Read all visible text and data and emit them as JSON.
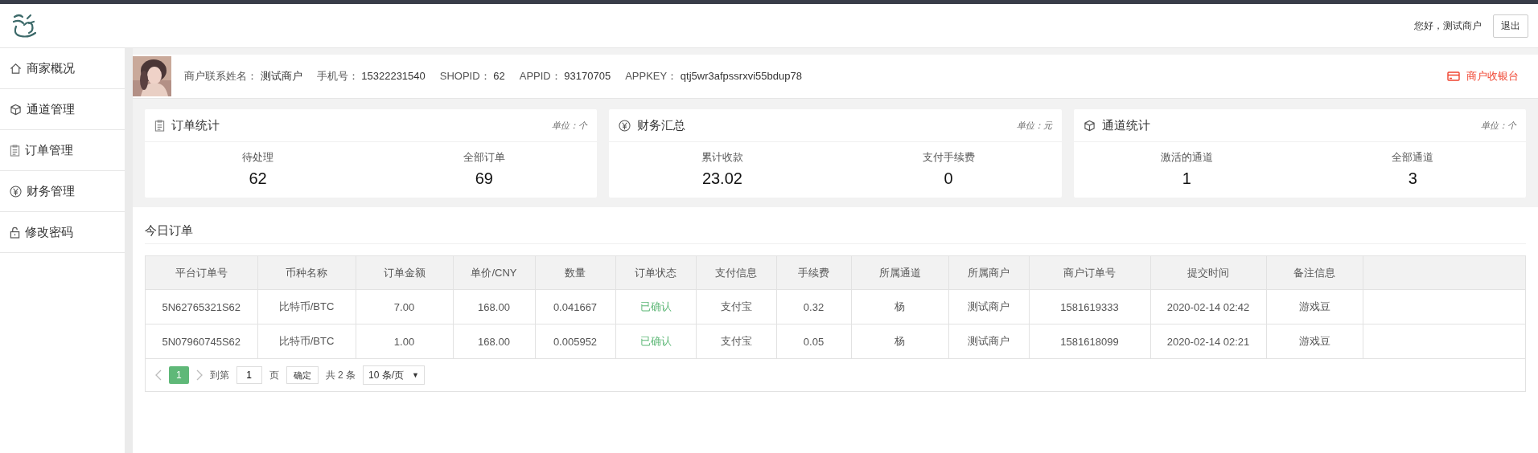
{
  "header": {
    "greeting": "您好，测试商户",
    "logout": "退出"
  },
  "sidebar": {
    "items": [
      {
        "label": "商家概况",
        "selected": false
      },
      {
        "label": "通道管理",
        "selected": false
      },
      {
        "label": "订单管理",
        "selected": false
      },
      {
        "label": "财务管理",
        "selected": false
      },
      {
        "label": "修改密码",
        "selected": false
      }
    ]
  },
  "merchant": {
    "fields": [
      {
        "label": "商户联系姓名：",
        "value": "测试商户"
      },
      {
        "label": "手机号：",
        "value": "15322231540"
      },
      {
        "label": "SHOPID：",
        "value": "62"
      },
      {
        "label": "APPID：",
        "value": "93170705"
      },
      {
        "label": "APPKEY：",
        "value": "qtj5wr3afpssrxvi55bdup78"
      }
    ],
    "cashier": "商户收银台"
  },
  "cards": [
    {
      "title": "订单统计",
      "unit": "单位：个",
      "stats": [
        {
          "label": "待处理",
          "value": "62"
        },
        {
          "label": "全部订单",
          "value": "69"
        }
      ]
    },
    {
      "title": "财务汇总",
      "unit": "单位：元",
      "stats": [
        {
          "label": "累计收款",
          "value": "23.02"
        },
        {
          "label": "支付手续费",
          "value": "0"
        }
      ]
    },
    {
      "title": "通道统计",
      "unit": "单位：个",
      "stats": [
        {
          "label": "激活的通道",
          "value": "1"
        },
        {
          "label": "全部通道",
          "value": "3"
        }
      ]
    }
  ],
  "orders": {
    "title": "今日订单",
    "columns": [
      {
        "label": "平台订单号",
        "kind": "text"
      },
      {
        "label": "币种名称",
        "kind": "text"
      },
      {
        "label": "订单金额",
        "kind": "text"
      },
      {
        "label": "单价/CNY",
        "kind": "text"
      },
      {
        "label": "数量",
        "kind": "text"
      },
      {
        "label": "订单状态",
        "kind": "status"
      },
      {
        "label": "支付信息",
        "kind": "text"
      },
      {
        "label": "手续费",
        "kind": "text"
      },
      {
        "label": "所属通道",
        "kind": "text"
      },
      {
        "label": "所属商户",
        "kind": "text"
      },
      {
        "label": "商户订单号",
        "kind": "text"
      },
      {
        "label": "提交时间",
        "kind": "text"
      },
      {
        "label": "备注信息",
        "kind": "text"
      }
    ],
    "rows": [
      [
        "5N62765321S62",
        "比特币/BTC",
        "7.00",
        "168.00",
        "0.041667",
        "已确认",
        "支付宝",
        "0.32",
        "杨",
        "测试商户",
        "1581619333",
        "2020-02-14 02:42",
        "游戏豆"
      ],
      [
        "5N07960745S62",
        "比特币/BTC",
        "1.00",
        "168.00",
        "0.005952",
        "已确认",
        "支付宝",
        "0.05",
        "杨",
        "测试商户",
        "1581618099",
        "2020-02-14 02:21",
        "游戏豆"
      ]
    ],
    "pagination": {
      "pages": [
        {
          "label": "1",
          "selected": true
        }
      ],
      "goto": "到第",
      "page_input": "1",
      "page_unit": "页",
      "confirm": "确定",
      "total": "共 2 条",
      "page_size": "10 条/页",
      "dropdown": "▼"
    }
  }
}
